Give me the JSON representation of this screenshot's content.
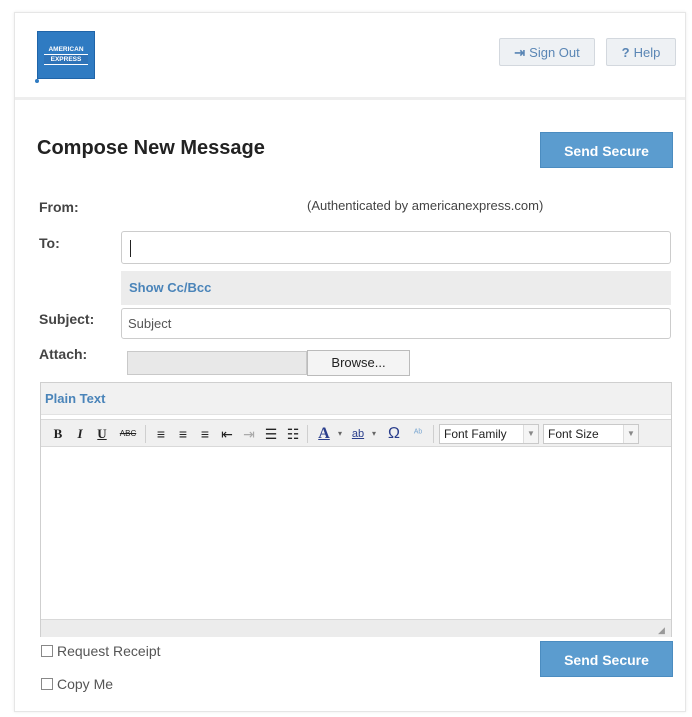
{
  "header": {
    "logo_line1": "AMERICAN",
    "logo_line2": "EXPRESS",
    "sign_out_label": "Sign Out",
    "help_label": "Help"
  },
  "compose": {
    "title": "Compose New Message",
    "send_secure_label": "Send Secure",
    "from_label": "From:",
    "from_value": "(Authenticated by americanexpress.com)",
    "to_label": "To:",
    "to_value": "",
    "show_cc_bcc_label": "Show Cc/Bcc",
    "subject_label": "Subject:",
    "subject_placeholder": "Subject",
    "attach_label": "Attach:",
    "browse_label": "Browse..."
  },
  "editor": {
    "plain_text_tab": "Plain Text",
    "toolbar": {
      "bold": "B",
      "italic": "I",
      "underline": "U",
      "strikethrough": "ABC",
      "font_family": "Font Family",
      "font_size": "Font Size"
    },
    "body_value": ""
  },
  "options": {
    "request_receipt_label": "Request Receipt",
    "copy_me_label": "Copy Me"
  },
  "colors": {
    "accent_blue": "#5b9ccf",
    "link_blue": "#4a84b9",
    "logo_blue": "#2f7bc2"
  }
}
